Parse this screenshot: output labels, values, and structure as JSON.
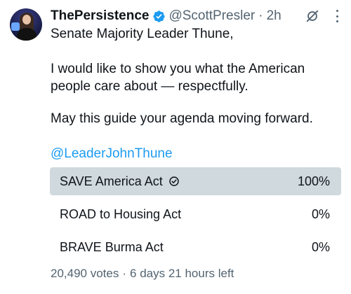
{
  "tweet": {
    "display_name": "ThePersistence",
    "handle": "@ScottPresler",
    "dot": "·",
    "time": "2h",
    "line1": "Senate Majority Leader Thune,",
    "para2": "I would like to show you what the American people care about — respectfully.",
    "para3": "May this guide your agenda moving forward.",
    "mention": "@LeaderJohnThune"
  },
  "poll": {
    "options": [
      {
        "label": "SAVE America Act",
        "percent_text": "100%",
        "percent": 100,
        "selected": true
      },
      {
        "label": "ROAD to Housing Act",
        "percent_text": "0%",
        "percent": 0,
        "selected": false
      },
      {
        "label": "BRAVE Burma Act",
        "percent_text": "0%",
        "percent": 0,
        "selected": false
      }
    ],
    "votes": "20,490 votes",
    "separator": "·",
    "time_left": "6 days 21 hours left"
  },
  "icons": {
    "verified": "verified-badge-icon",
    "grok": "grok-icon",
    "more": "more-options-icon",
    "check": "check-circle-icon"
  },
  "colors": {
    "accent": "#1d9bf0",
    "verified": "#1d9bf0",
    "poll_fill": "#cfd9de",
    "secondary_text": "#536471"
  }
}
